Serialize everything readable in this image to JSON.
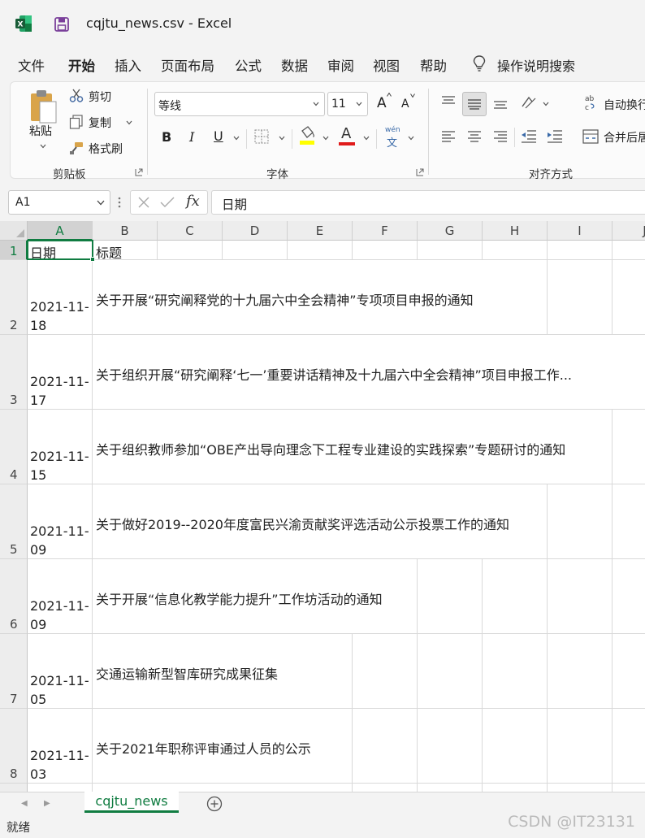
{
  "window": {
    "title": "cqjtu_news.csv  -  Excel",
    "accent_color": "#107c41"
  },
  "menu": {
    "items": [
      "文件",
      "开始",
      "插入",
      "页面布局",
      "公式",
      "数据",
      "审阅",
      "视图",
      "帮助"
    ],
    "active": "开始",
    "search_label": "操作说明搜索"
  },
  "ribbon": {
    "clipboard": {
      "paste_label": "粘贴",
      "cut_label": "剪切",
      "copy_label": "复制",
      "format_painter_label": "格式刷",
      "group_label": "剪贴板"
    },
    "font": {
      "font_name": "等线",
      "font_size": "11",
      "bold_label": "B",
      "italic_label": "I",
      "underline_label": "U",
      "font_color_letter": "A",
      "grow_label": "A",
      "shrink_label": "A",
      "phonetic_top": "wén",
      "phonetic_bottom": "文",
      "group_label": "字体"
    },
    "alignment": {
      "wrap_text_label": "自动换行",
      "merge_label": "合并后居",
      "group_label": "对齐方式"
    }
  },
  "formula_bar": {
    "name_box": "A1",
    "formula": "日期",
    "fx_label": "fx"
  },
  "grid": {
    "columns": [
      "A",
      "B",
      "C",
      "D",
      "E",
      "F",
      "G",
      "H",
      "I",
      "J"
    ],
    "header_row": {
      "date": "日期",
      "title": "标题"
    },
    "rows": [
      {
        "num": "2",
        "date_line1": "2021-11-",
        "date_line2": "18",
        "title": "关于开展“研究阐释党的十九届六中全会精神”专项项目申报的通知"
      },
      {
        "num": "3",
        "date_line1": "2021-11-",
        "date_line2": "17",
        "title": "关于组织开展“研究阐释‘七一’重要讲话精神及十九届六中全会精神”项目申报工作..."
      },
      {
        "num": "4",
        "date_line1": "2021-11-",
        "date_line2": "15",
        "title": "关于组织教师参加“OBE产出导向理念下工程专业建设的实践探索”专题研讨的通知"
      },
      {
        "num": "5",
        "date_line1": "2021-11-",
        "date_line2": "09",
        "title": "关于做好2019--2020年度富民兴渝贡献奖评选活动公示投票工作的通知"
      },
      {
        "num": "6",
        "date_line1": "2021-11-",
        "date_line2": "09",
        "title": "关于开展“信息化教学能力提升”工作坊活动的通知"
      },
      {
        "num": "7",
        "date_line1": "2021-11-",
        "date_line2": "05",
        "title": "交通运输新型智库研究成果征集"
      },
      {
        "num": "8",
        "date_line1": "2021-11-",
        "date_line2": "03",
        "title": "关于2021年职称评审通过人员的公示"
      }
    ]
  },
  "sheet_tabs": {
    "active": "cqjtu_news"
  },
  "status_bar": {
    "ready": "就绪"
  },
  "watermark": "CSDN @IT23131"
}
